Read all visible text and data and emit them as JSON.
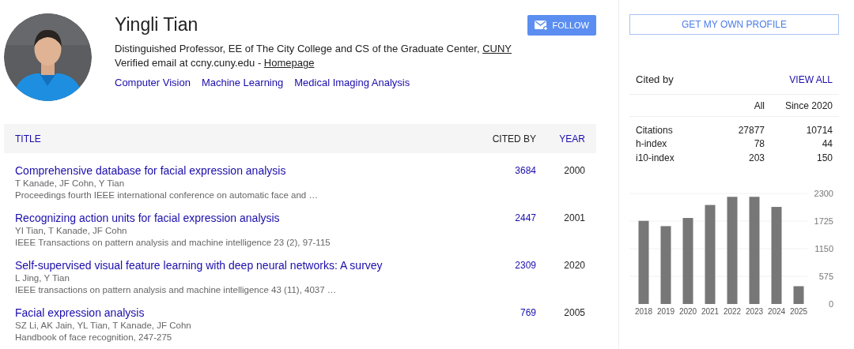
{
  "profile": {
    "name": "Yingli Tian",
    "affiliation": "Distinguished Professor, EE of The City College and CS of the Graduate Center, ",
    "affiliation_link": "CUNY",
    "email": "Verified email at ccny.cuny.edu - ",
    "homepage": "Homepage",
    "interests": [
      "Computer Vision",
      "Machine Learning",
      "Medical Imaging Analysis"
    ],
    "follow_button": "FOLLOW"
  },
  "table": {
    "columns": [
      {
        "label": "TITLE",
        "selected": false
      },
      {
        "label": "CITED BY",
        "selected": true
      },
      {
        "label": "YEAR",
        "selected": false
      }
    ],
    "rows": [
      {
        "title": "Comprehensive database for facial expression analysis",
        "authors": "T Kanade, JF Cohn, Y Tian",
        "venue": "Proceedings fourth IEEE international conference on automatic face and …",
        "cited_by": "3684",
        "year": "2000"
      },
      {
        "title": "Recognizing action units for facial expression analysis",
        "authors": "YI Tian, T Kanade, JF Cohn",
        "venue": "IEEE Transactions on pattern analysis and machine intelligence 23 (2), 97-115",
        "cited_by": "2447",
        "year": "2001"
      },
      {
        "title": "Self-supervised visual feature learning with deep neural networks: A survey",
        "authors": "L Jing, Y Tian",
        "venue": "IEEE transactions on pattern analysis and machine intelligence 43 (11), 4037 …",
        "cited_by": "2309",
        "year": "2020"
      },
      {
        "title": "Facial expression analysis",
        "authors": "SZ Li, AK Jain, YL Tian, T Kanade, JF Cohn",
        "venue": "Handbook of face recognition, 247-275",
        "cited_by": "769",
        "year": "2005"
      }
    ]
  },
  "sidebar": {
    "profile_button": "GET MY OWN PROFILE",
    "cited_by": {
      "heading": "Cited by",
      "view_all": "VIEW ALL",
      "columns": [
        "All",
        "Since 2020"
      ],
      "rows": [
        {
          "label": "Citations",
          "all": "27877",
          "since": "10714"
        },
        {
          "label": "h-index",
          "all": "78",
          "since": "44"
        },
        {
          "label": "i10-index",
          "all": "203",
          "since": "150"
        }
      ]
    },
    "chart_data": {
      "type": "bar",
      "categories": [
        "2018",
        "2019",
        "2020",
        "2021",
        "2022",
        "2023",
        "2024",
        "2025"
      ],
      "series": [
        {
          "color": "#777777",
          "values": [
            1730,
            1620,
            1790,
            2060,
            2230,
            2230,
            2020,
            370
          ]
        }
      ],
      "ylim": [
        0,
        2300
      ],
      "grid": true,
      "yticks": [
        0,
        575,
        1150,
        1725,
        2300
      ]
    }
  }
}
